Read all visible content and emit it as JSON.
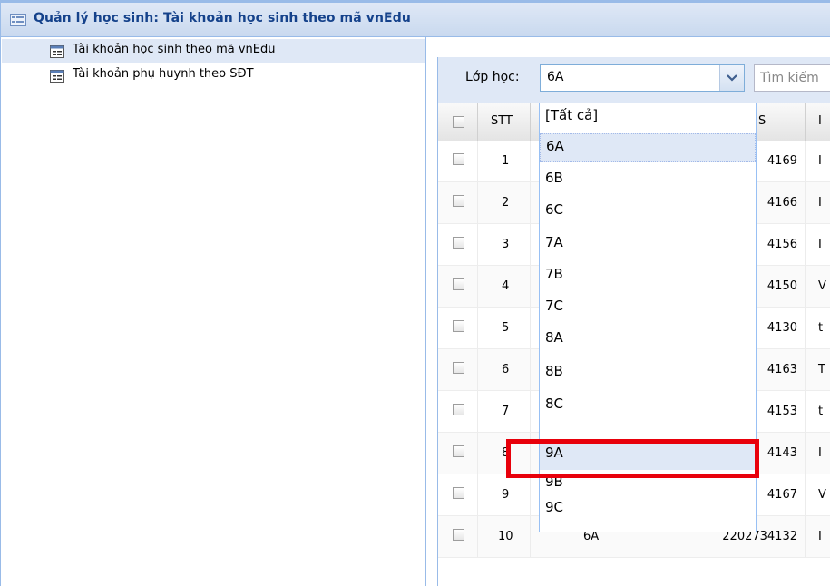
{
  "panel": {
    "title": "Quản lý học sinh: Tài khoản học sinh theo mã vnEdu"
  },
  "sidebar": {
    "items": [
      {
        "label": "Tài khoản học sinh theo mã vnEdu",
        "selected": true
      },
      {
        "label": "Tài khoản phụ huynh theo SĐT",
        "selected": false
      }
    ]
  },
  "toolbar": {
    "class_label": "Lớp học:",
    "class_value": "6A",
    "search_placeholder": "Tìm kiếm"
  },
  "grid": {
    "columns": [
      "",
      "STT",
      "",
      "S",
      "I"
    ],
    "rows": [
      {
        "stt": "1",
        "class": "",
        "id": "4169",
        "name": "I"
      },
      {
        "stt": "2",
        "class": "",
        "id": "4166",
        "name": "I"
      },
      {
        "stt": "3",
        "class": "",
        "id": "4156",
        "name": "I"
      },
      {
        "stt": "4",
        "class": "",
        "id": "4150",
        "name": "V"
      },
      {
        "stt": "5",
        "class": "",
        "id": "4130",
        "name": "t"
      },
      {
        "stt": "6",
        "class": "",
        "id": "4163",
        "name": "T"
      },
      {
        "stt": "7",
        "class": "",
        "id": "4153",
        "name": "t"
      },
      {
        "stt": "8",
        "class": "",
        "id": "4143",
        "name": "I"
      },
      {
        "stt": "9",
        "class": "",
        "id": "4167",
        "name": "V"
      },
      {
        "stt": "10",
        "class": "6A",
        "id": "2202734132",
        "name": "I"
      }
    ]
  },
  "dropdown": {
    "options": [
      "[Tất cả]",
      "6A",
      "6B",
      "6C",
      "7A",
      "7B",
      "7C",
      "8A",
      "8B",
      "8C",
      "9A",
      "9B",
      "9C"
    ],
    "selected": "6A",
    "highlighted": "9A"
  },
  "colors": {
    "accent": "#15428b",
    "highlight": "#e8000b",
    "header_bg": "#dfe8f6"
  }
}
